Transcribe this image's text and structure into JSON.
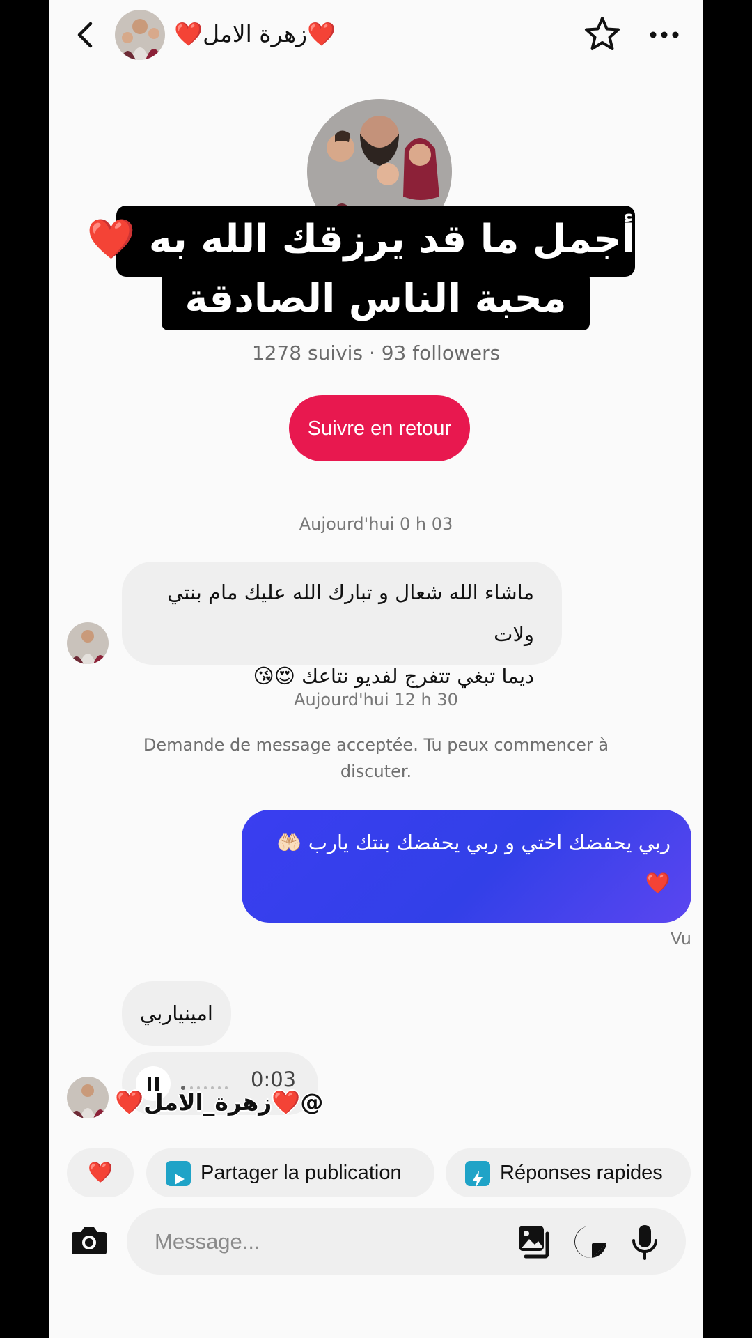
{
  "header": {
    "name": "❤️زهرة الامل❤️",
    "back_icon": "chevron-left-icon",
    "favorite_icon": "star-outline-icon",
    "more_icon": "more-horizontal-icon"
  },
  "overlay": {
    "caption_line1": "أجمل ما قد يرزقك الله به ❤️",
    "caption_line2": "محبة الناس الصادقة"
  },
  "profile": {
    "stats": "1278 suivis · 93 followers",
    "follow_back_label": "Suivre en retour"
  },
  "conversation": {
    "timestamp_1": "Aujourd'hui 0 h 03",
    "message_1_line1": "ماشاء الله شعال و تبارك الله عليك مام بنتي ولات",
    "message_1_line2": "ديما تبغي تتفرج لفديو نتاعك 😍😘",
    "timestamp_2": "Aujourd'hui 12 h 30",
    "system_note": "Demande de message acceptée. Tu peux commencer à discuter.",
    "sent_message_line1": "ربي يحفضك اختي و ربي يحفضك بنتك يارب 🤲🏻",
    "sent_message_line2": "❤️",
    "seen_label": "Vu",
    "message_2": "امينياربي",
    "voice_duration": "0:03"
  },
  "watermark": "@❤️زهرة_الامل❤️",
  "quick_actions": {
    "heart": "❤️",
    "share_label": "Partager la publication",
    "quick_replies_label": "Réponses rapides"
  },
  "composer": {
    "placeholder": "Message..."
  },
  "colors": {
    "follow_button": "#e8184f",
    "sent_bubble": "#3a3ef0",
    "share_icon": "#1fa3c7"
  }
}
